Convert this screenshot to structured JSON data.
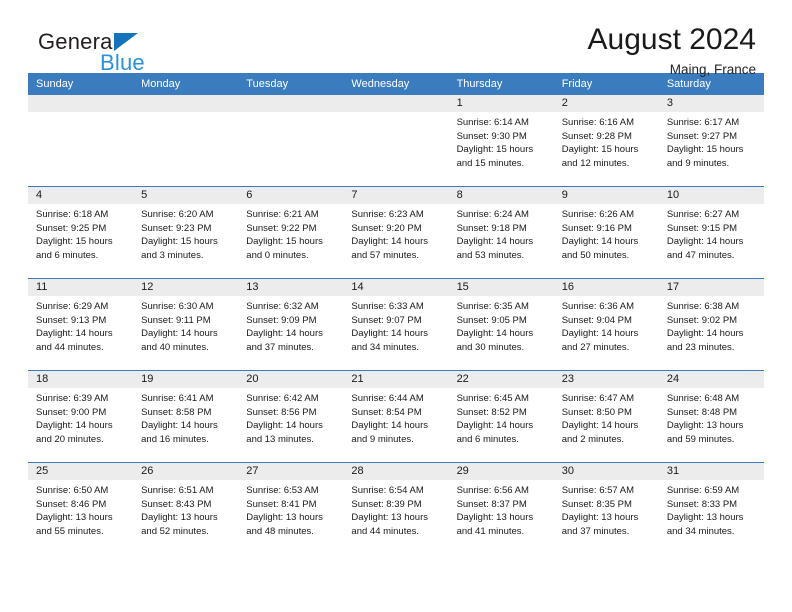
{
  "brand": {
    "name_top": "General",
    "name_bottom": "Blue",
    "triangle_color": "#1573bb",
    "blue_color": "#2a92d8"
  },
  "header": {
    "title": "August 2024",
    "subtitle": "Maing, France",
    "header_bg": "#3a7cbe",
    "daynum_bg": "#ececec"
  },
  "weekday_headers": [
    "Sunday",
    "Monday",
    "Tuesday",
    "Wednesday",
    "Thursday",
    "Friday",
    "Saturday"
  ],
  "labels": {
    "sunrise_prefix": "Sunrise: ",
    "sunset_prefix": "Sunset: ",
    "daylight_prefix": "Daylight: "
  },
  "weeks": [
    [
      {
        "day": "",
        "sunrise": "",
        "sunset": "",
        "daylight_line1": "",
        "daylight_line2": ""
      },
      {
        "day": "",
        "sunrise": "",
        "sunset": "",
        "daylight_line1": "",
        "daylight_line2": ""
      },
      {
        "day": "",
        "sunrise": "",
        "sunset": "",
        "daylight_line1": "",
        "daylight_line2": ""
      },
      {
        "day": "",
        "sunrise": "",
        "sunset": "",
        "daylight_line1": "",
        "daylight_line2": ""
      },
      {
        "day": "1",
        "sunrise": "Sunrise: 6:14 AM",
        "sunset": "Sunset: 9:30 PM",
        "daylight_line1": "Daylight: 15 hours",
        "daylight_line2": "and 15 minutes."
      },
      {
        "day": "2",
        "sunrise": "Sunrise: 6:16 AM",
        "sunset": "Sunset: 9:28 PM",
        "daylight_line1": "Daylight: 15 hours",
        "daylight_line2": "and 12 minutes."
      },
      {
        "day": "3",
        "sunrise": "Sunrise: 6:17 AM",
        "sunset": "Sunset: 9:27 PM",
        "daylight_line1": "Daylight: 15 hours",
        "daylight_line2": "and 9 minutes."
      }
    ],
    [
      {
        "day": "4",
        "sunrise": "Sunrise: 6:18 AM",
        "sunset": "Sunset: 9:25 PM",
        "daylight_line1": "Daylight: 15 hours",
        "daylight_line2": "and 6 minutes."
      },
      {
        "day": "5",
        "sunrise": "Sunrise: 6:20 AM",
        "sunset": "Sunset: 9:23 PM",
        "daylight_line1": "Daylight: 15 hours",
        "daylight_line2": "and 3 minutes."
      },
      {
        "day": "6",
        "sunrise": "Sunrise: 6:21 AM",
        "sunset": "Sunset: 9:22 PM",
        "daylight_line1": "Daylight: 15 hours",
        "daylight_line2": "and 0 minutes."
      },
      {
        "day": "7",
        "sunrise": "Sunrise: 6:23 AM",
        "sunset": "Sunset: 9:20 PM",
        "daylight_line1": "Daylight: 14 hours",
        "daylight_line2": "and 57 minutes."
      },
      {
        "day": "8",
        "sunrise": "Sunrise: 6:24 AM",
        "sunset": "Sunset: 9:18 PM",
        "daylight_line1": "Daylight: 14 hours",
        "daylight_line2": "and 53 minutes."
      },
      {
        "day": "9",
        "sunrise": "Sunrise: 6:26 AM",
        "sunset": "Sunset: 9:16 PM",
        "daylight_line1": "Daylight: 14 hours",
        "daylight_line2": "and 50 minutes."
      },
      {
        "day": "10",
        "sunrise": "Sunrise: 6:27 AM",
        "sunset": "Sunset: 9:15 PM",
        "daylight_line1": "Daylight: 14 hours",
        "daylight_line2": "and 47 minutes."
      }
    ],
    [
      {
        "day": "11",
        "sunrise": "Sunrise: 6:29 AM",
        "sunset": "Sunset: 9:13 PM",
        "daylight_line1": "Daylight: 14 hours",
        "daylight_line2": "and 44 minutes."
      },
      {
        "day": "12",
        "sunrise": "Sunrise: 6:30 AM",
        "sunset": "Sunset: 9:11 PM",
        "daylight_line1": "Daylight: 14 hours",
        "daylight_line2": "and 40 minutes."
      },
      {
        "day": "13",
        "sunrise": "Sunrise: 6:32 AM",
        "sunset": "Sunset: 9:09 PM",
        "daylight_line1": "Daylight: 14 hours",
        "daylight_line2": "and 37 minutes."
      },
      {
        "day": "14",
        "sunrise": "Sunrise: 6:33 AM",
        "sunset": "Sunset: 9:07 PM",
        "daylight_line1": "Daylight: 14 hours",
        "daylight_line2": "and 34 minutes."
      },
      {
        "day": "15",
        "sunrise": "Sunrise: 6:35 AM",
        "sunset": "Sunset: 9:05 PM",
        "daylight_line1": "Daylight: 14 hours",
        "daylight_line2": "and 30 minutes."
      },
      {
        "day": "16",
        "sunrise": "Sunrise: 6:36 AM",
        "sunset": "Sunset: 9:04 PM",
        "daylight_line1": "Daylight: 14 hours",
        "daylight_line2": "and 27 minutes."
      },
      {
        "day": "17",
        "sunrise": "Sunrise: 6:38 AM",
        "sunset": "Sunset: 9:02 PM",
        "daylight_line1": "Daylight: 14 hours",
        "daylight_line2": "and 23 minutes."
      }
    ],
    [
      {
        "day": "18",
        "sunrise": "Sunrise: 6:39 AM",
        "sunset": "Sunset: 9:00 PM",
        "daylight_line1": "Daylight: 14 hours",
        "daylight_line2": "and 20 minutes."
      },
      {
        "day": "19",
        "sunrise": "Sunrise: 6:41 AM",
        "sunset": "Sunset: 8:58 PM",
        "daylight_line1": "Daylight: 14 hours",
        "daylight_line2": "and 16 minutes."
      },
      {
        "day": "20",
        "sunrise": "Sunrise: 6:42 AM",
        "sunset": "Sunset: 8:56 PM",
        "daylight_line1": "Daylight: 14 hours",
        "daylight_line2": "and 13 minutes."
      },
      {
        "day": "21",
        "sunrise": "Sunrise: 6:44 AM",
        "sunset": "Sunset: 8:54 PM",
        "daylight_line1": "Daylight: 14 hours",
        "daylight_line2": "and 9 minutes."
      },
      {
        "day": "22",
        "sunrise": "Sunrise: 6:45 AM",
        "sunset": "Sunset: 8:52 PM",
        "daylight_line1": "Daylight: 14 hours",
        "daylight_line2": "and 6 minutes."
      },
      {
        "day": "23",
        "sunrise": "Sunrise: 6:47 AM",
        "sunset": "Sunset: 8:50 PM",
        "daylight_line1": "Daylight: 14 hours",
        "daylight_line2": "and 2 minutes."
      },
      {
        "day": "24",
        "sunrise": "Sunrise: 6:48 AM",
        "sunset": "Sunset: 8:48 PM",
        "daylight_line1": "Daylight: 13 hours",
        "daylight_line2": "and 59 minutes."
      }
    ],
    [
      {
        "day": "25",
        "sunrise": "Sunrise: 6:50 AM",
        "sunset": "Sunset: 8:46 PM",
        "daylight_line1": "Daylight: 13 hours",
        "daylight_line2": "and 55 minutes."
      },
      {
        "day": "26",
        "sunrise": "Sunrise: 6:51 AM",
        "sunset": "Sunset: 8:43 PM",
        "daylight_line1": "Daylight: 13 hours",
        "daylight_line2": "and 52 minutes."
      },
      {
        "day": "27",
        "sunrise": "Sunrise: 6:53 AM",
        "sunset": "Sunset: 8:41 PM",
        "daylight_line1": "Daylight: 13 hours",
        "daylight_line2": "and 48 minutes."
      },
      {
        "day": "28",
        "sunrise": "Sunrise: 6:54 AM",
        "sunset": "Sunset: 8:39 PM",
        "daylight_line1": "Daylight: 13 hours",
        "daylight_line2": "and 44 minutes."
      },
      {
        "day": "29",
        "sunrise": "Sunrise: 6:56 AM",
        "sunset": "Sunset: 8:37 PM",
        "daylight_line1": "Daylight: 13 hours",
        "daylight_line2": "and 41 minutes."
      },
      {
        "day": "30",
        "sunrise": "Sunrise: 6:57 AM",
        "sunset": "Sunset: 8:35 PM",
        "daylight_line1": "Daylight: 13 hours",
        "daylight_line2": "and 37 minutes."
      },
      {
        "day": "31",
        "sunrise": "Sunrise: 6:59 AM",
        "sunset": "Sunset: 8:33 PM",
        "daylight_line1": "Daylight: 13 hours",
        "daylight_line2": "and 34 minutes."
      }
    ]
  ]
}
